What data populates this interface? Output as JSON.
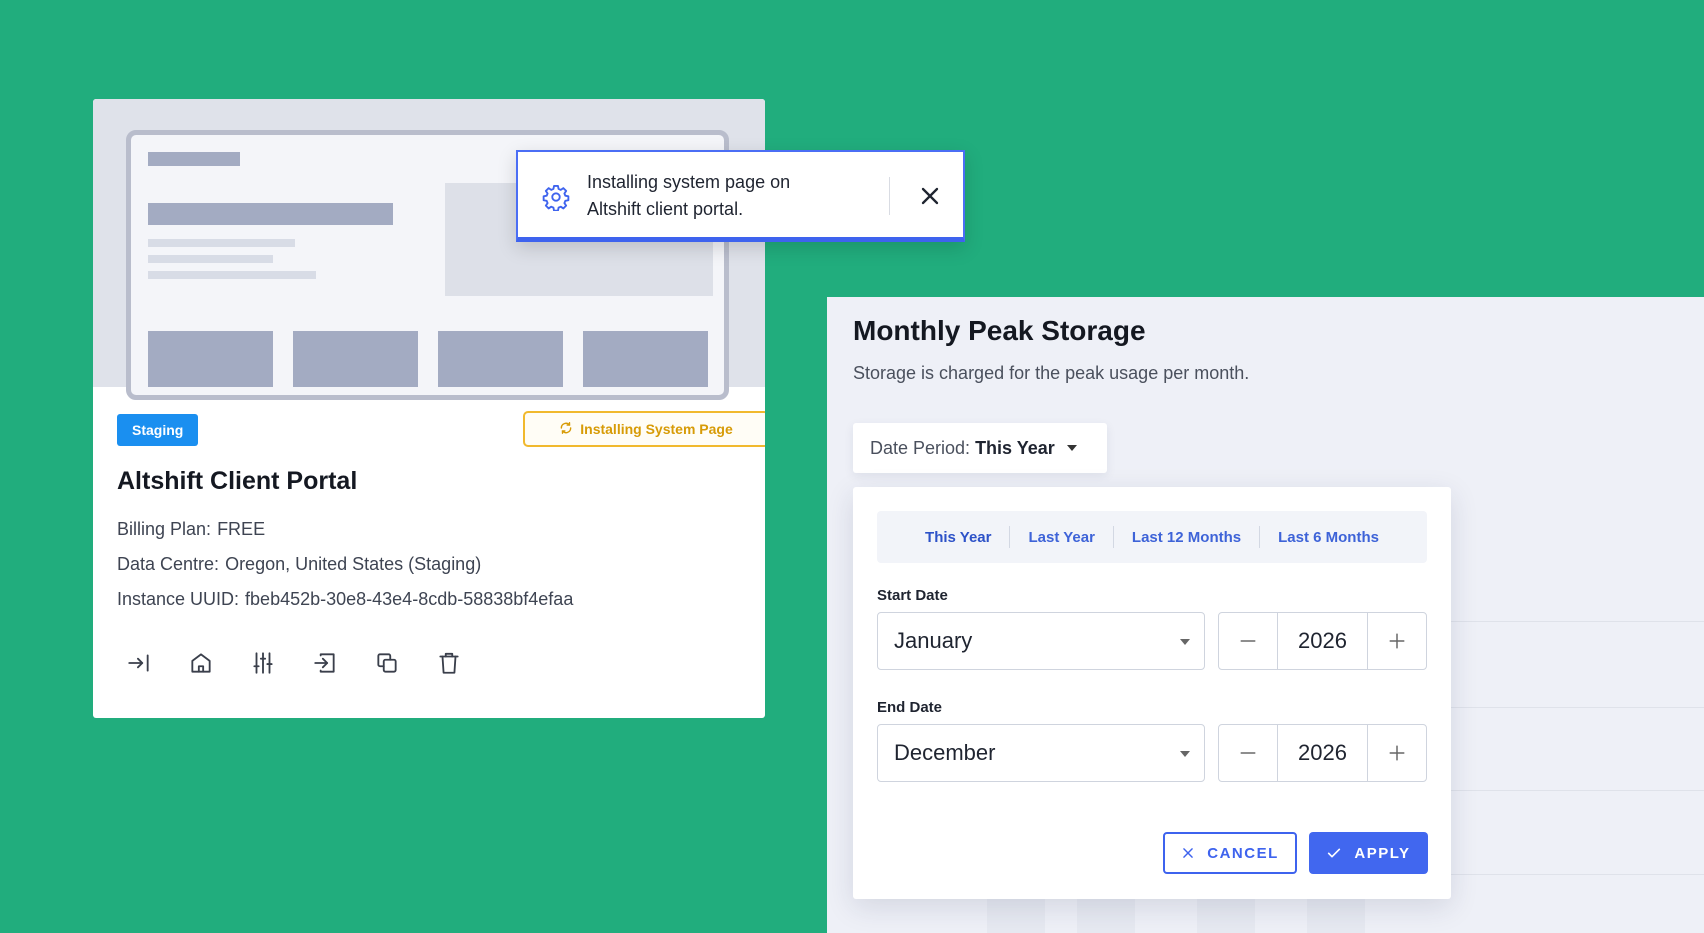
{
  "site_card": {
    "badge": "Staging",
    "status": "Installing System Page",
    "title": "Altshift Client Portal",
    "billing_label": "Billing Plan:",
    "billing_value": "FREE",
    "datacentre_label": "Data Centre:",
    "datacentre_value": "Oregon, United States (Staging)",
    "uuid_label": "Instance UUID:",
    "uuid_value": "fbeb452b-30e8-43e4-8cdb-58838bf4efaa",
    "actions": [
      "login-icon",
      "home-icon",
      "sliders-icon",
      "migrate-icon",
      "copy-icon",
      "trash-icon"
    ]
  },
  "toast": {
    "message": "Installing system page on Altshift client portal."
  },
  "storage": {
    "title": "Monthly Peak Storage",
    "subtitle": "Storage is charged for the peak usage per month.",
    "period_label": "Date Period:",
    "period_value": "This Year",
    "quick_ranges": [
      "This Year",
      "Last Year",
      "Last 12 Months",
      "Last 6 Months"
    ],
    "start_label": "Start Date",
    "start_month": "January",
    "start_year": "2026",
    "end_label": "End Date",
    "end_month": "December",
    "end_year": "2026",
    "cancel_label": "CANCEL",
    "apply_label": "APPLY"
  },
  "colors": {
    "background": "#21ad7d",
    "accent": "#4167ef",
    "staging_badge": "#1a8ff0",
    "installing": "#f1b92e"
  }
}
